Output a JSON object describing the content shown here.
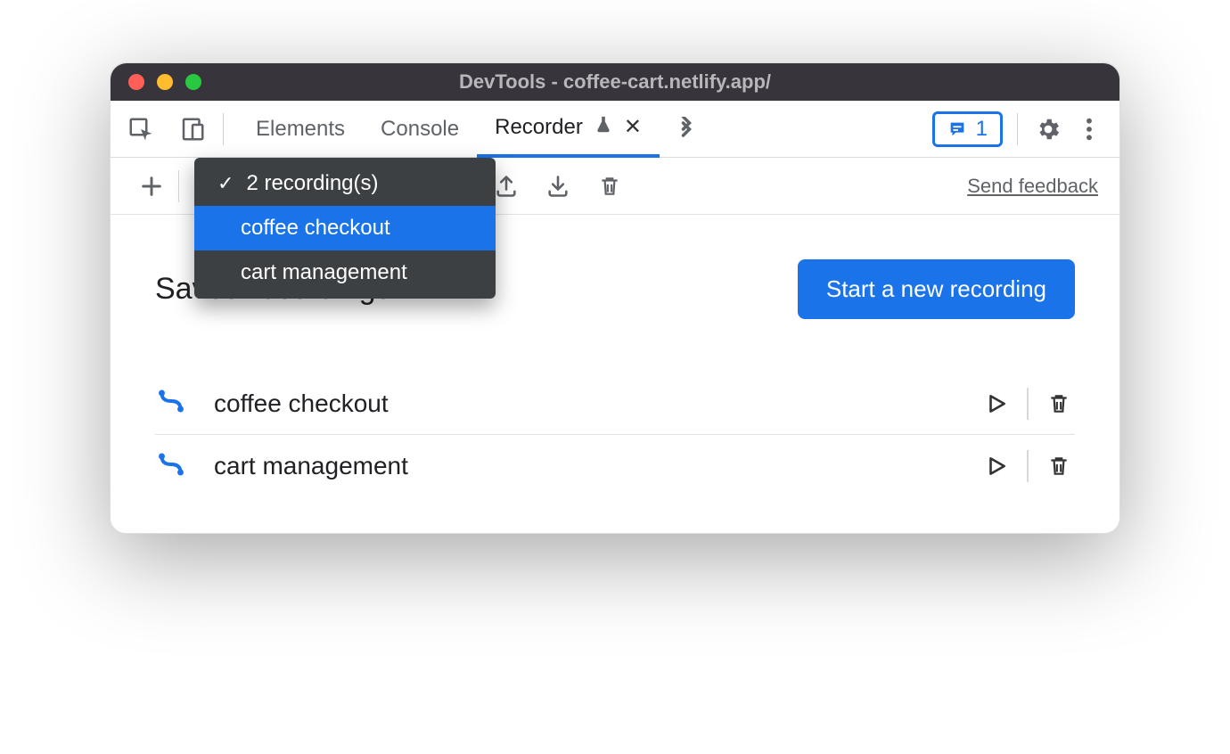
{
  "window": {
    "title": "DevTools - coffee-cart.netlify.app/"
  },
  "tabs": {
    "elements": "Elements",
    "console": "Console",
    "recorder": "Recorder"
  },
  "messages_count": "1",
  "toolbar": {
    "send_feedback": "Send feedback"
  },
  "dropdown": {
    "header": "2 recording(s)",
    "items": [
      {
        "label": "coffee checkout",
        "selected": true
      },
      {
        "label": "cart management",
        "selected": false
      }
    ]
  },
  "page": {
    "title": "Saved recordings",
    "start_button": "Start a new recording"
  },
  "recordings": [
    {
      "label": "coffee checkout"
    },
    {
      "label": "cart management"
    }
  ]
}
